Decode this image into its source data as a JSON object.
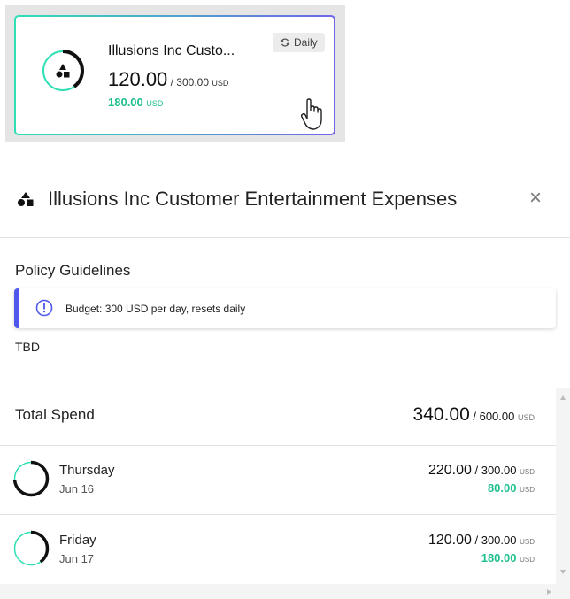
{
  "card": {
    "title": "Illusions Inc Custo...",
    "amount": "120.00",
    "limit": " / 300.00 ",
    "unit": "USD",
    "remaining": "180.00",
    "remaining_unit": "USD",
    "badge_label": "Daily",
    "progress": 0.4
  },
  "panel": {
    "title": "Illusions Inc Customer Entertainment Expenses",
    "close_symbol": "×"
  },
  "guidelines": {
    "label": "Policy Guidelines",
    "notice": "Budget: 300 USD per day, resets daily",
    "note": "TBD"
  },
  "total": {
    "label": "Total Spend",
    "amount": "340.00",
    "limit": " / 600.00 ",
    "unit": "USD"
  },
  "days": [
    {
      "name": "Thursday",
      "date": "Jun 16",
      "amount": "220.00",
      "limit": " / 300.00 ",
      "unit": "USD",
      "remaining": "80.00",
      "remaining_unit": "USD",
      "progress": 0.7333
    },
    {
      "name": "Friday",
      "date": "Jun 17",
      "amount": "120.00",
      "limit": " / 300.00 ",
      "unit": "USD",
      "remaining": "180.00",
      "remaining_unit": "USD",
      "progress": 0.4
    }
  ],
  "colors": {
    "accent_green": "#1fbf8f",
    "ring_track": "#2fe0b5",
    "ring_fill": "#111111",
    "notice_bar": "#4f58ea"
  }
}
